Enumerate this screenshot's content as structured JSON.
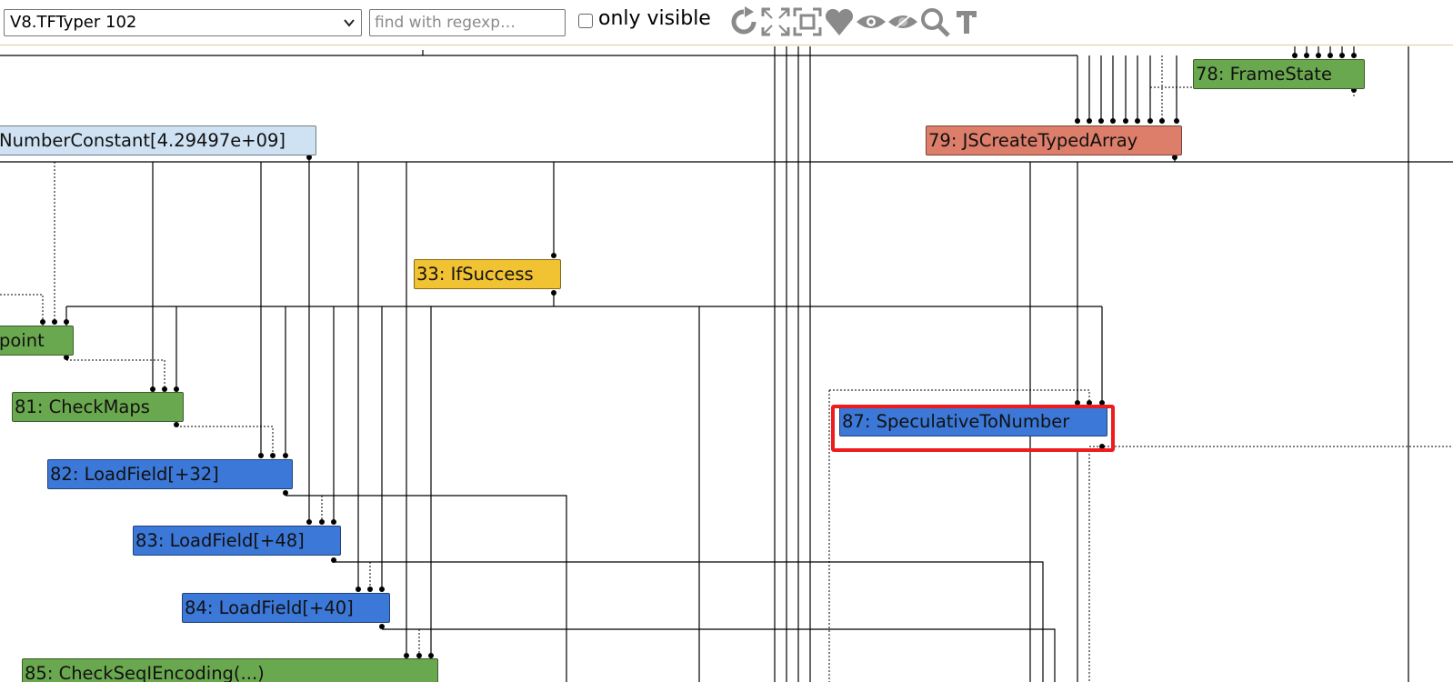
{
  "toolbar": {
    "phase_select": "V8.TFTyper 102",
    "search_placeholder": "find with regexp…",
    "only_visible_label": "only visible",
    "only_visible_checked": false,
    "icons": [
      "layout-icon",
      "show-all-icon",
      "toggle-hide-dead-icon",
      "toggle-types-icon",
      "hide-selected-icon",
      "hide-unselected-icon",
      "zoom-selection-icon",
      "toggle-types-text-icon"
    ]
  },
  "nodes": {
    "n78": "78: FrameState",
    "n79": "79: JSCreateTypedArray",
    "nconst": "NumberConstant[4.29497e+09]",
    "n33": "33: IfSuccess",
    "ncheckpoint": "point",
    "n81": "81: CheckMaps",
    "n82": "82: LoadField[+32]",
    "n83": "83: LoadField[+48]",
    "n84": "84: LoadField[+40]",
    "n85": "85: CheckSeqIEncoding(...)",
    "n87": "87: SpeculativeToNumber"
  },
  "colors": {
    "control": "#f1c232",
    "js": "#dd7e6b",
    "simplified": "#3c78d8",
    "input": "#cfe2f3",
    "other": "#6aa84f",
    "highlight": "#ee1c1c"
  }
}
